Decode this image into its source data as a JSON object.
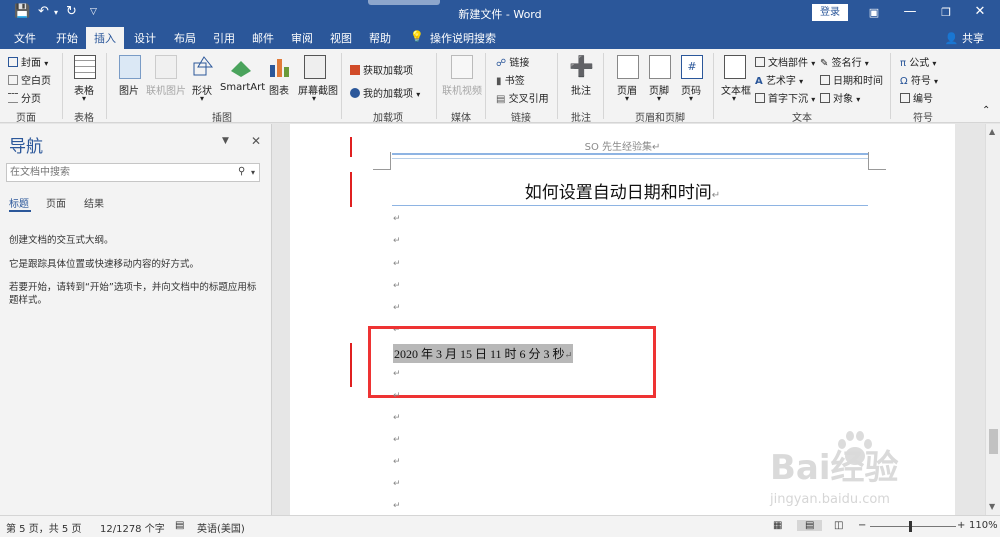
{
  "window": {
    "title": "新建文件 - Word",
    "login_label": "登录",
    "share_label": "共享"
  },
  "tabs": [
    "文件",
    "开始",
    "插入",
    "设计",
    "布局",
    "引用",
    "邮件",
    "审阅",
    "视图",
    "帮助",
    "操作说明搜索"
  ],
  "active_tab": "插入",
  "ribbon": {
    "pages": {
      "cover": "封面",
      "blank": "空白页",
      "break": "分页",
      "group": "页面"
    },
    "table": {
      "label": "表格",
      "group": "表格"
    },
    "illustrations": {
      "pictures": "图片",
      "online_pictures": "联机图片",
      "shapes": "形状",
      "smartart": "SmartArt",
      "chart": "图表",
      "screenshot": "屏幕截图",
      "group": "插图"
    },
    "addins": {
      "get": "获取加载项",
      "my": "我的加载项",
      "group": "加载项"
    },
    "media": {
      "online_video": "联机视频",
      "group": "媒体"
    },
    "links": {
      "link": "链接",
      "bookmark": "书签",
      "cross_ref": "交叉引用",
      "group": "链接"
    },
    "comments": {
      "comment": "批注",
      "group": "批注"
    },
    "header_footer": {
      "header": "页眉",
      "footer": "页脚",
      "page_number": "页码",
      "group": "页眉和页脚"
    },
    "text": {
      "textbox": "文本框",
      "quick_parts": "文档部件",
      "wordart": "艺术字",
      "dropcap": "首字下沉",
      "signature": "签名行",
      "datetime": "日期和时间",
      "object": "对象",
      "group": "文本"
    },
    "symbols": {
      "equation": "公式",
      "symbol": "符号",
      "number": "编号",
      "group": "符号"
    }
  },
  "nav": {
    "title": "导航",
    "search_placeholder": "在文档中搜索",
    "tabs": [
      "标题",
      "页面",
      "结果"
    ],
    "line1": "创建文档的交互式大纲。",
    "line2": "它是跟踪具体位置或快速移动内容的好方式。",
    "line3": "若要开始，请转到“开始”选项卡，并向文档中的标题应用标题样式。"
  },
  "document": {
    "header_text": "SO 先生经验集",
    "title": "如何设置自动日期和时间",
    "date_text": "2020 年 3 月 15 日 11 时 6 分 3 秒",
    "para_mark": "↵"
  },
  "status": {
    "page": "第 5 页，共 5 页",
    "words": "12/1278 个字",
    "language": "英语(美国)",
    "zoom": "110%",
    "zoom_minus": "−",
    "zoom_plus": "+"
  },
  "watermark": {
    "brand": "Bai经验",
    "url": "jingyan.baidu.com"
  }
}
